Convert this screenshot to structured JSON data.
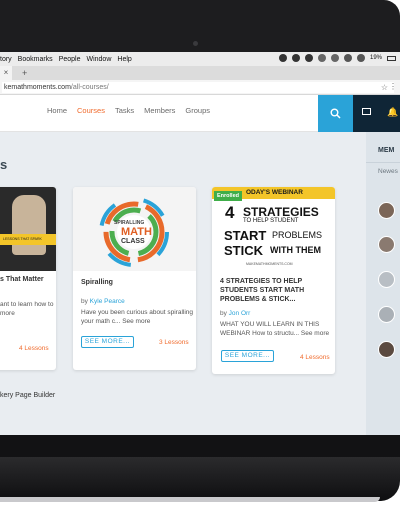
{
  "menubar": {
    "items": [
      "tory",
      "Bookmarks",
      "People",
      "Window",
      "Help"
    ],
    "battery": "19%"
  },
  "browser": {
    "tab_close": "×",
    "new_tab": "+",
    "url_host": "kemathmoments.com",
    "url_path": "/all-courses/"
  },
  "nav": {
    "items": [
      "Home",
      "Courses",
      "Tasks",
      "Members",
      "Groups"
    ],
    "active": "Courses"
  },
  "header": {
    "search_icon": "search-icon",
    "mail_icon": "mail-icon",
    "bell_icon": "bell-icon"
  },
  "page": {
    "heading": "s"
  },
  "courses": [
    {
      "title": "s That Matter",
      "desc_line1": "ant to learn how to",
      "desc_line2": "more",
      "lessons": "4 Lessons",
      "image_text": "LESSONS THAT SPARK"
    },
    {
      "title": "Spiralling",
      "by": "by ",
      "author": "Kyle Pearce",
      "desc_line1": "Have you been curious about spiralling",
      "desc_line2": "your math c...",
      "see_more_link": "See more",
      "button": "SEE MORE...",
      "lessons": "3 Lessons",
      "image_text_1": "SPIRALLING",
      "image_text_2": "MATH",
      "image_text_3": "CLASS"
    },
    {
      "badge": "Enrolled",
      "image_top": "ODAY'S WEBINAR",
      "image_big_1": "4",
      "image_big_2": "STRATEGIES",
      "image_big_3": "TO HELP STUDENT",
      "image_big_4": "START",
      "image_big_5": "PROBLEMS",
      "image_big_6": "STICK",
      "image_big_7": "WITH THEM",
      "image_url": "MAKEMATHMOMENTS.COM",
      "title_line1": "4 STRATEGIES TO HELP",
      "title_line2": "STUDENTS START MATH",
      "title_line3": "PROBLEMS & STICK...",
      "by": "by ",
      "author": "Jon Orr",
      "desc_line1": "WHAT YOU WILL LEARN IN THIS",
      "desc_line2": "WEBINAR How to structu...",
      "see_more_link": "See more",
      "button": "SEE MORE...",
      "lessons": "4 Lessons"
    }
  ],
  "footer": {
    "text": "kery Page Builder"
  },
  "sidebar": {
    "title": "MEM",
    "tab": "Newes"
  },
  "colors": {
    "accent": "#2aa3d8",
    "active_nav": "#f06b2d",
    "header_dark": "#0f2536",
    "enrolled": "#3fae49"
  }
}
